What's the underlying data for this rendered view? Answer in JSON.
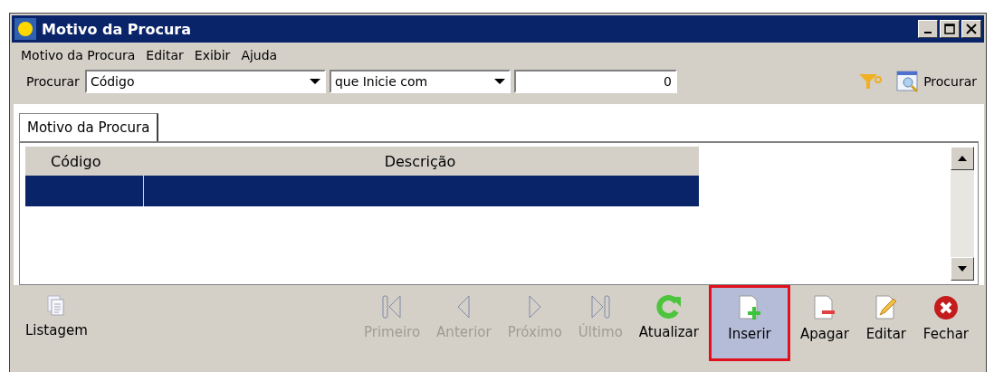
{
  "window": {
    "title": "Motivo da Procura"
  },
  "menu": [
    {
      "label": "Motivo da Procura"
    },
    {
      "label": "Editar"
    },
    {
      "label": "Exibir"
    },
    {
      "label": "Ajuda"
    }
  ],
  "search": {
    "label": "Procurar",
    "field": "Código",
    "operator": "que Inicie com",
    "value": "0",
    "button": "Procurar"
  },
  "tabs": [
    {
      "label": "Motivo da Procura",
      "selected": true
    }
  ],
  "table": {
    "columns": [
      "Código",
      "Descrição"
    ],
    "rows": [
      {
        "cells": [
          "",
          ""
        ],
        "selected": true
      }
    ]
  },
  "toolbar": [
    {
      "label": "Listagem",
      "kind": "list",
      "disabled": false,
      "selected": false
    },
    {
      "kind": "spacer"
    },
    {
      "label": "Primeiro",
      "kind": "first",
      "disabled": true,
      "selected": false
    },
    {
      "label": "Anterior",
      "kind": "prev",
      "disabled": true,
      "selected": false
    },
    {
      "label": "Próximo",
      "kind": "next",
      "disabled": true,
      "selected": false
    },
    {
      "label": "Último",
      "kind": "last",
      "disabled": true,
      "selected": false
    },
    {
      "label": "Atualizar",
      "kind": "refresh",
      "disabled": false,
      "selected": false
    },
    {
      "label": "Inserir",
      "kind": "insert",
      "disabled": false,
      "selected": true
    },
    {
      "label": "Apagar",
      "kind": "delete",
      "disabled": false,
      "selected": false
    },
    {
      "label": "Editar",
      "kind": "edit",
      "disabled": false,
      "selected": false
    },
    {
      "label": "Fechar",
      "kind": "close",
      "disabled": false,
      "selected": false
    }
  ]
}
